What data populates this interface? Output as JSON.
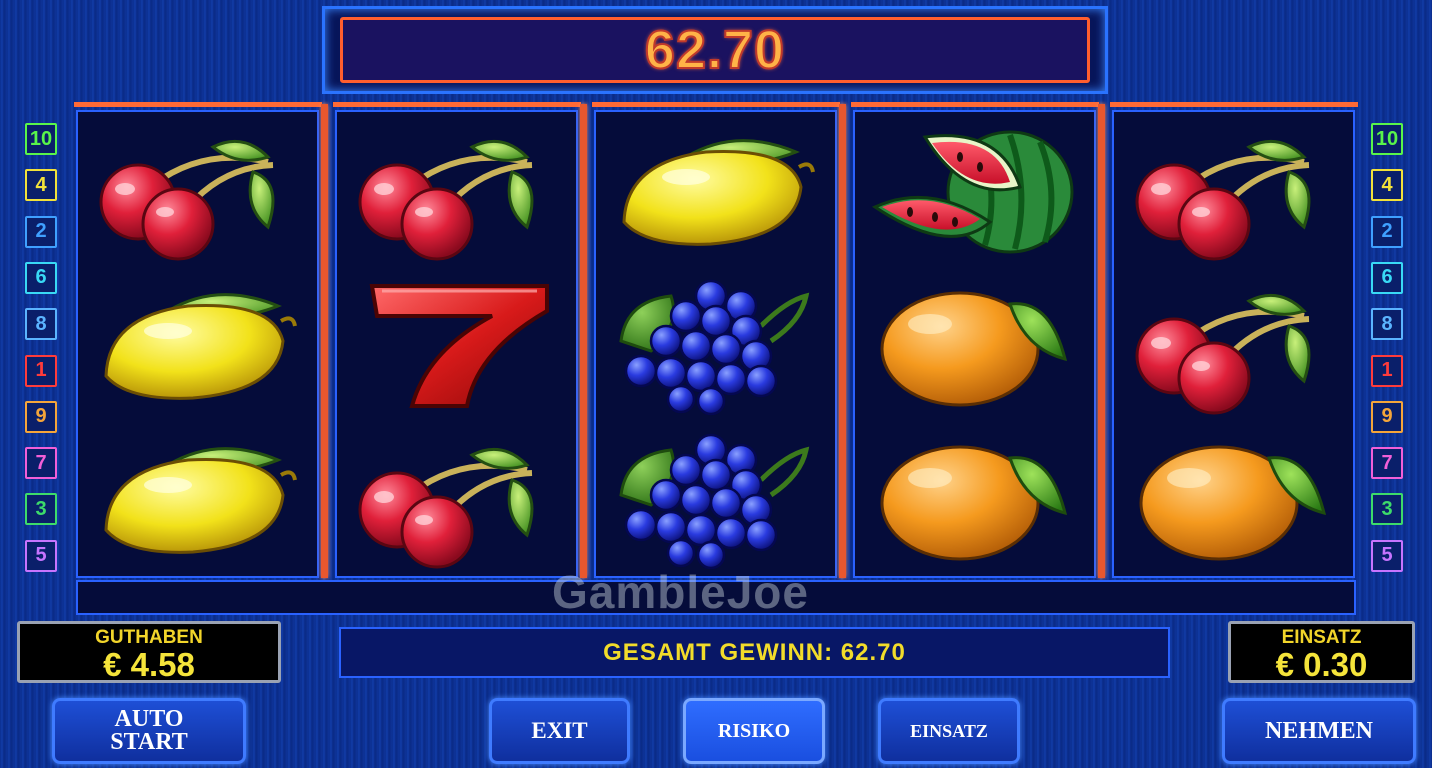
{
  "win_display": {
    "value": "62.70"
  },
  "line_numbers": {
    "left": [
      {
        "n": "10",
        "color": "#59f54a"
      },
      {
        "n": "4",
        "color": "#f2e13a"
      },
      {
        "n": "2",
        "color": "#3fa0ff"
      },
      {
        "n": "6",
        "color": "#39d9f5"
      },
      {
        "n": "8",
        "color": "#5bb4ff"
      },
      {
        "n": "1",
        "color": "#ff3b3b"
      },
      {
        "n": "9",
        "color": "#f5a53a"
      },
      {
        "n": "7",
        "color": "#f25fd8"
      },
      {
        "n": "3",
        "color": "#3ddb6a"
      },
      {
        "n": "5",
        "color": "#c774ff"
      }
    ],
    "right": [
      {
        "n": "10",
        "color": "#59f54a"
      },
      {
        "n": "4",
        "color": "#f2e13a"
      },
      {
        "n": "2",
        "color": "#3fa0ff"
      },
      {
        "n": "6",
        "color": "#39d9f5"
      },
      {
        "n": "8",
        "color": "#5bb4ff"
      },
      {
        "n": "1",
        "color": "#ff3b3b"
      },
      {
        "n": "9",
        "color": "#f5a53a"
      },
      {
        "n": "7",
        "color": "#f25fd8"
      },
      {
        "n": "3",
        "color": "#3ddb6a"
      },
      {
        "n": "5",
        "color": "#c774ff"
      }
    ]
  },
  "reels": [
    [
      "cherry-icon",
      "lemon-icon",
      "lemon-icon"
    ],
    [
      "cherry-icon",
      "seven-icon",
      "cherry-icon"
    ],
    [
      "lemon-icon",
      "grapes-icon",
      "grapes-icon"
    ],
    [
      "watermelon-icon",
      "orange-icon",
      "orange-icon"
    ],
    [
      "cherry-icon",
      "cherry-icon",
      "orange-icon"
    ]
  ],
  "guthaben": {
    "label": "GUTHABEN",
    "value": "€ 4.58"
  },
  "einsatz_panel": {
    "label": "EINSATZ",
    "value": "€ 0.30"
  },
  "gesamt_gewinn": "GESAMT GEWINN: 62.70",
  "buttons": {
    "auto_start_line1": "AUTO",
    "auto_start_line2": "START",
    "exit": "EXIT",
    "risiko": "RISIKO",
    "einsatz": "EINSATZ",
    "nehmen": "NEHMEN"
  },
  "watermark": "GambleJoe"
}
